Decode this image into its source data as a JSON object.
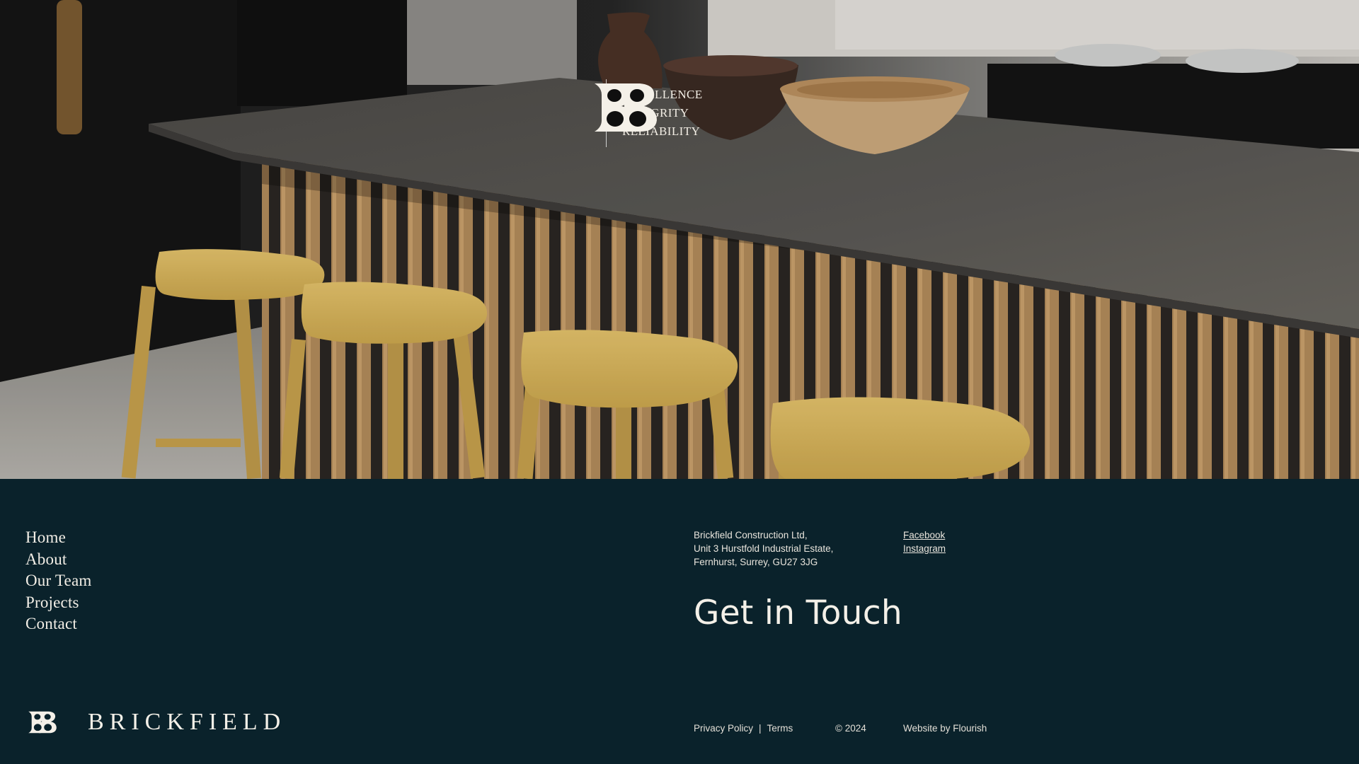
{
  "hero": {
    "taglines": [
      "EXCELLENCE",
      "INTEGRITY",
      "RELIABILITY"
    ]
  },
  "footer": {
    "nav": [
      "Home",
      "About",
      "Our Team",
      "Projects",
      "Contact"
    ],
    "address": [
      "Brickfield Construction Ltd,",
      "Unit 3 Hurstfold Industrial Estate,",
      "Fernhurst, Surrey, GU27 3JG"
    ],
    "socials": [
      "Facebook",
      "Instagram"
    ],
    "heading": "Get in Touch",
    "brand_name": "BRICKFIELD",
    "privacy_policy": "Privacy Policy",
    "separator": "|",
    "terms": "Terms",
    "copyright": "© 2024",
    "credit": "Website by Flourish"
  },
  "colors": {
    "footer_bg": "#0a222b",
    "text": "#f2eee6",
    "stool_yellow": "#d7b65e",
    "counter_grey": "#555350",
    "slat_oak": "#a87f50"
  },
  "icons": [
    "brickfield-monogram-icon"
  ]
}
